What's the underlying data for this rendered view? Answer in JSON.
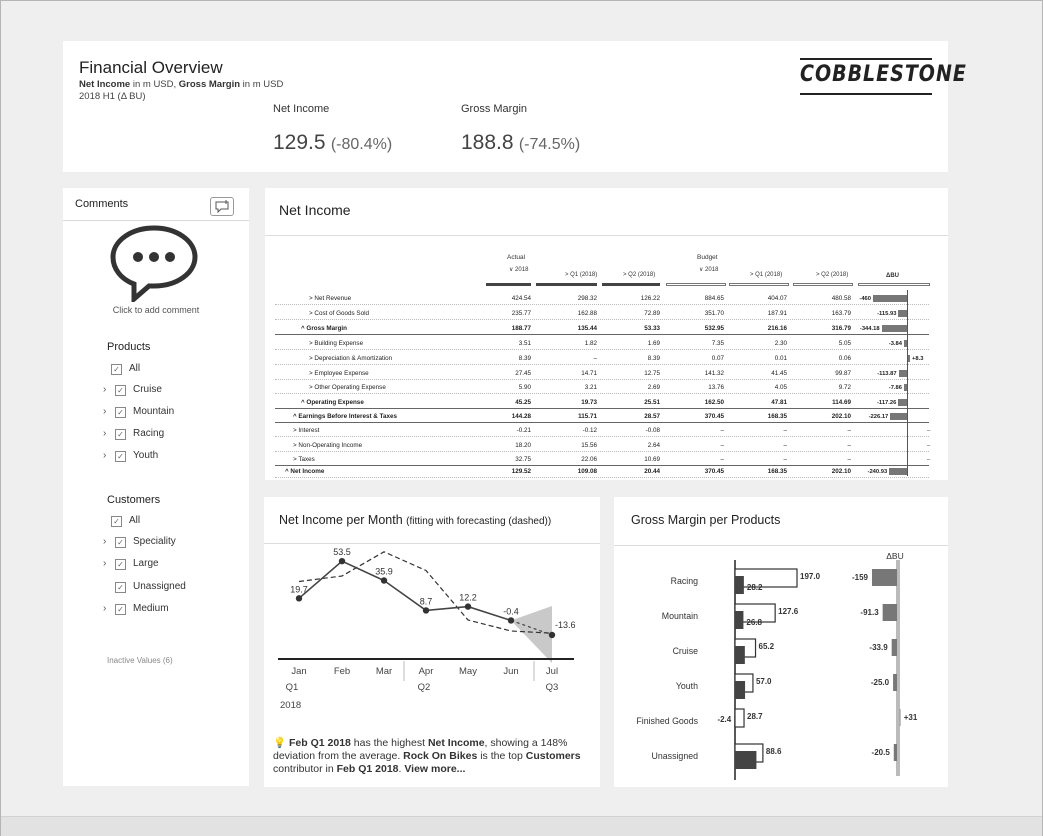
{
  "header": {
    "title": "Financial Overview",
    "subtitle_a_bold": "Net Income",
    "subtitle_a_rest": " in m USD, ",
    "subtitle_b_bold": "Gross Margin",
    "subtitle_b_rest": " in m USD",
    "period": "2018 H1 (Δ BU)",
    "logo": "COBBLESTONE",
    "kpis": [
      {
        "label": "Net Income",
        "value": "129.5",
        "delta": "(-80.4%)"
      },
      {
        "label": "Gross Margin",
        "value": "188.8",
        "delta": "(-74.5%)"
      }
    ]
  },
  "comments": {
    "title": "Comments",
    "add_icon": "add-comment-icon",
    "hint": "Click to add comment",
    "products_title": "Products",
    "products": [
      {
        "label": "All",
        "expand": false
      },
      {
        "label": "Cruise",
        "expand": true
      },
      {
        "label": "Mountain",
        "expand": true
      },
      {
        "label": "Racing",
        "expand": true
      },
      {
        "label": "Youth",
        "expand": true
      }
    ],
    "customers_title": "Customers",
    "customers": [
      {
        "label": "All",
        "expand": false
      },
      {
        "label": "Speciality",
        "expand": true
      },
      {
        "label": "Large",
        "expand": true
      },
      {
        "label": "Unassigned",
        "expand": false
      },
      {
        "label": "Medium",
        "expand": true
      }
    ],
    "inactive": "Inactive Values (6)"
  },
  "net_income_table": {
    "title": "Net Income",
    "group_actual": "Actual",
    "group_budget": "Budget",
    "columns": [
      "∨ 2018",
      "> Q1 (2018)",
      "> Q2 (2018)",
      "∨ 2018",
      "> Q1 (2018)",
      "> Q2 (2018)"
    ],
    "dbu_header": "ΔBU",
    "rows": [
      {
        "label": "> Net Revenue",
        "indent": 3,
        "bold": false,
        "values": [
          "424.54",
          "298.32",
          "126.22",
          "884.65",
          "404.07",
          "480.58"
        ],
        "dbu": "-460",
        "dbu_val": -460
      },
      {
        "label": "> Cost of Goods Sold",
        "indent": 3,
        "bold": false,
        "values": [
          "235.77",
          "162.88",
          "72.89",
          "351.70",
          "187.91",
          "163.79"
        ],
        "dbu": "-115.93",
        "dbu_val": -115.93
      },
      {
        "label": "^ Gross Margin",
        "indent": 2,
        "bold": true,
        "values": [
          "188.77",
          "135.44",
          "53.33",
          "532.95",
          "216.16",
          "316.79"
        ],
        "dbu": "-344.18",
        "dbu_val": -344.18
      },
      {
        "label": "> Building Expense",
        "indent": 3,
        "bold": false,
        "values": [
          "3.51",
          "1.82",
          "1.69",
          "7.35",
          "2.30",
          "5.05"
        ],
        "dbu": "-3.84",
        "dbu_val": -3.84
      },
      {
        "label": "> Depreciation & Amortization",
        "indent": 3,
        "bold": false,
        "values": [
          "8.39",
          "–",
          "8.39",
          "0.07",
          "0.01",
          "0.06"
        ],
        "dbu": "+8.3",
        "dbu_val": 8.3
      },
      {
        "label": "> Employee Expense",
        "indent": 3,
        "bold": false,
        "values": [
          "27.45",
          "14.71",
          "12.75",
          "141.32",
          "41.45",
          "99.87"
        ],
        "dbu": "-113.87",
        "dbu_val": -113.87
      },
      {
        "label": "> Other Operating Expense",
        "indent": 3,
        "bold": false,
        "values": [
          "5.90",
          "3.21",
          "2.69",
          "13.76",
          "4.05",
          "9.72"
        ],
        "dbu": "-7.86",
        "dbu_val": -7.86
      },
      {
        "label": "^ Operating Expense",
        "indent": 2,
        "bold": true,
        "values": [
          "45.25",
          "19.73",
          "25.51",
          "162.50",
          "47.81",
          "114.69"
        ],
        "dbu": "-117.26",
        "dbu_val": -117.26
      },
      {
        "label": "^ Earnings Before Interest & Taxes",
        "indent": 1,
        "bold": true,
        "values": [
          "144.28",
          "115.71",
          "28.57",
          "370.45",
          "168.35",
          "202.10"
        ],
        "dbu": "-226.17",
        "dbu_val": -226.17
      },
      {
        "label": "> Interest",
        "indent": 1,
        "bold": false,
        "values": [
          "-0.21",
          "-0.12",
          "-0.08",
          "–",
          "–",
          "–"
        ],
        "dbu": "–",
        "dbu_val": 0
      },
      {
        "label": "> Non-Operating Income",
        "indent": 1,
        "bold": false,
        "values": [
          "18.20",
          "15.56",
          "2.64",
          "–",
          "–",
          "–"
        ],
        "dbu": "–",
        "dbu_val": 0
      },
      {
        "label": "> Taxes",
        "indent": 1,
        "bold": false,
        "values": [
          "32.75",
          "22.06",
          "10.69",
          "–",
          "–",
          "–"
        ],
        "dbu": "–",
        "dbu_val": 0
      },
      {
        "label": "^ Net Income",
        "indent": 0,
        "bold": true,
        "values": [
          "129.52",
          "109.08",
          "20.44",
          "370.45",
          "168.35",
          "202.10"
        ],
        "dbu": "-240.93",
        "dbu_val": -240.93
      }
    ]
  },
  "net_income_month": {
    "title": "Net Income per Month",
    "title_suffix": "(fitting with forecasting (dashed))",
    "months": [
      "Jan",
      "Feb",
      "Mar",
      "Apr",
      "May",
      "Jun",
      "Jul"
    ],
    "quarters": [
      "Q1",
      "Q2",
      "Q3"
    ],
    "year": "2018",
    "footer": {
      "p1": "Feb Q1 2018",
      "p2": " has the highest ",
      "p3": "Net Income",
      "p4": ", showing a 148% deviation from the average. ",
      "p5": "Rock On Bikes",
      "p6": " is the top ",
      "p7": "Customers",
      "p8": " contributor in ",
      "p9": "Feb Q1 2018",
      "p10": ". ",
      "p11": "View more..."
    }
  },
  "gross_margin_products": {
    "title": "Gross Margin per Products",
    "dbu_header": "ΔBU",
    "items": [
      {
        "label": "Racing",
        "actual": 28.2,
        "actual_label": "28.2",
        "budget": 197.0,
        "budget_label": "197.0",
        "dbu": -159,
        "dbu_label": "-159"
      },
      {
        "label": "Mountain",
        "actual": 26.8,
        "actual_label": "26.8",
        "budget": 127.6,
        "budget_label": "127.6",
        "dbu": -91.3,
        "dbu_label": "-91.3"
      },
      {
        "label": "Cruise",
        "actual": 31.3,
        "actual_label": "",
        "budget": 65.2,
        "budget_label": "65.2",
        "dbu": -33.9,
        "dbu_label": "-33.9"
      },
      {
        "label": "Youth",
        "actual": 32.0,
        "actual_label": "",
        "budget": 57.0,
        "budget_label": "57.0",
        "dbu": -25.0,
        "dbu_label": "-25.0"
      },
      {
        "label": "Finished Goods",
        "actual": -2.4,
        "actual_label": "-2.4",
        "budget": 28.7,
        "budget_label": "28.7",
        "dbu": 31,
        "dbu_label": "+31"
      },
      {
        "label": "Unassigned",
        "actual": 68.1,
        "actual_label": "",
        "budget": 88.6,
        "budget_label": "88.6",
        "dbu": -20.5,
        "dbu_label": "-20.5"
      }
    ]
  },
  "chart_data": [
    {
      "type": "line",
      "title": "Net Income per Month",
      "categories": [
        "Jan",
        "Feb",
        "Mar",
        "Apr",
        "May",
        "Jun",
        "Jul"
      ],
      "series": [
        {
          "name": "Net Income",
          "values": [
            19.7,
            53.5,
            35.9,
            8.7,
            12.2,
            -0.4,
            -13.6
          ]
        },
        {
          "name": "fitting with forecasting (dashed)",
          "values": [
            35,
            40,
            62,
            45,
            0,
            -10,
            -12
          ]
        }
      ],
      "xlabel": "",
      "ylabel": ""
    },
    {
      "type": "bar",
      "title": "Gross Margin per Products",
      "categories": [
        "Racing",
        "Mountain",
        "Cruise",
        "Youth",
        "Finished Goods",
        "Unassigned"
      ],
      "series": [
        {
          "name": "",
          "values": [
            28.2,
            26.8,
            31.3,
            32.0,
            -2.4,
            68.1
          ]
        },
        {
          "name": "",
          "values": [
            197.0,
            127.6,
            65.2,
            57.0,
            28.7,
            88.6
          ]
        },
        {
          "name": "ΔBU",
          "values": [
            -159,
            -91.3,
            -33.9,
            -25.0,
            31,
            -20.5
          ]
        }
      ]
    }
  ]
}
